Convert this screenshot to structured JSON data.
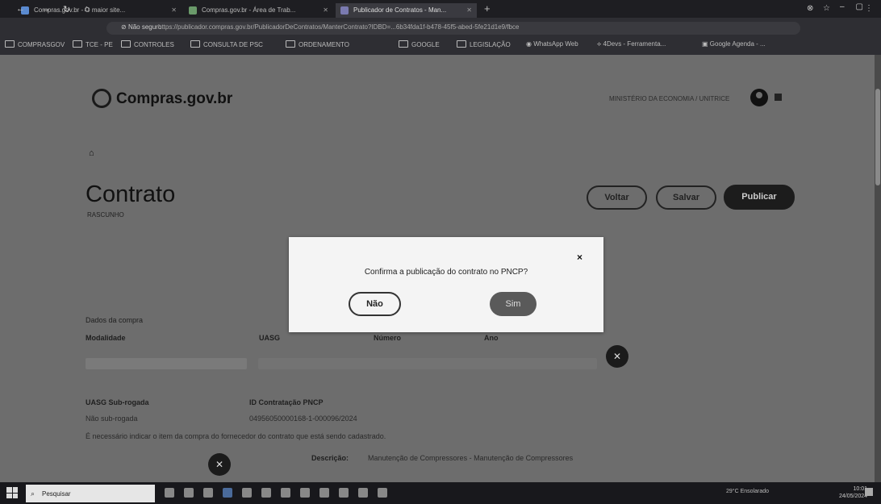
{
  "browser": {
    "tabs": [
      {
        "label": "Compras.gov.br - O maior site..."
      },
      {
        "label": "Compras.gov.br - Área de Trab..."
      },
      {
        "label": "Publicador de Contratos - Man..."
      }
    ],
    "url_security": "Não seguro",
    "url": "https://publicador.compras.gov.br/PublicadorDeContratos/ManterContrato?IDBD=...6b34fda1f-b478-45f5-abed-5fe21d1e9/fbce",
    "bookmarks": [
      "COMPRASGOV",
      "TCE - PE",
      "CONTROLES",
      "CONSULTA DE PSC",
      "ORDENAMENTO",
      "GOOGLE",
      "LEGISLAÇÃO",
      "WhatsApp Web",
      "4Devs - Ferramenta...",
      "Google Agenda - ..."
    ]
  },
  "header": {
    "logo": "Compras.gov.br",
    "ministry": "MINISTÉRIO DA ECONOMIA / UNITRICE"
  },
  "page": {
    "title": "Contrato",
    "status": "RASCUNHO",
    "buttons": {
      "voltar": "Voltar",
      "salvar": "Salvar",
      "publicar": "Publicar"
    }
  },
  "form": {
    "section": "Dados da compra",
    "labels": {
      "modalidade": "Modalidade",
      "uasg": "UASG",
      "numero": "Número",
      "ano": "Ano"
    },
    "uasg_subrogada_label": "UASG Sub-rogada",
    "uasg_subrogada_value": "Não sub-rogada",
    "id_pncp_label": "ID Contratação PNCP",
    "id_pncp_value": "04956050000168-1-000096/2024",
    "note": "É necessário indicar o item da compra do fornecedor do contrato que está sendo cadastrado.",
    "descricao_label": "Descrição:",
    "descricao_value": "Manutenção de Compressores - Manutenção de Compressores"
  },
  "modal": {
    "question": "Confirma a publicação do contrato no PNCP?",
    "no": "Não",
    "yes": "Sim",
    "close": "×"
  },
  "taskbar": {
    "search": "Pesquisar",
    "weather": "29°C Ensolarado",
    "time": "10:01",
    "date": "24/05/2024"
  }
}
